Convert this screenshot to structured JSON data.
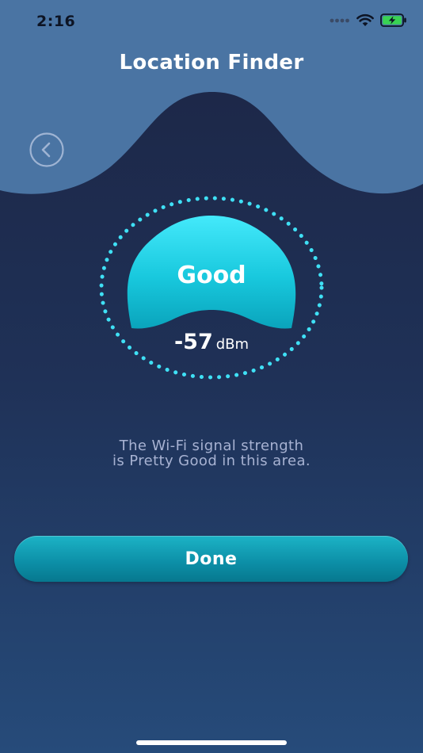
{
  "status_bar": {
    "time": "2:16",
    "icons": [
      "signal-dots-icon",
      "wifi-icon",
      "battery-charging-icon"
    ]
  },
  "header": {
    "title": "Location Finder",
    "back_icon": "chevron-left-icon"
  },
  "gauge": {
    "label": "Good",
    "signal_value": "-57",
    "signal_unit": "dBm"
  },
  "message": {
    "line1": "The Wi-Fi signal strength",
    "line2": "is Pretty Good in this area."
  },
  "actions": {
    "done_label": "Done"
  },
  "colors": {
    "header_wave": "#4a74a3",
    "background_top": "#1c2544",
    "background_bottom": "#264b7a",
    "accent_cyan": "#3fe0f5",
    "button_teal": "#0c8ea6",
    "battery_green": "#39d353",
    "message_text": "#a7b2d2"
  }
}
